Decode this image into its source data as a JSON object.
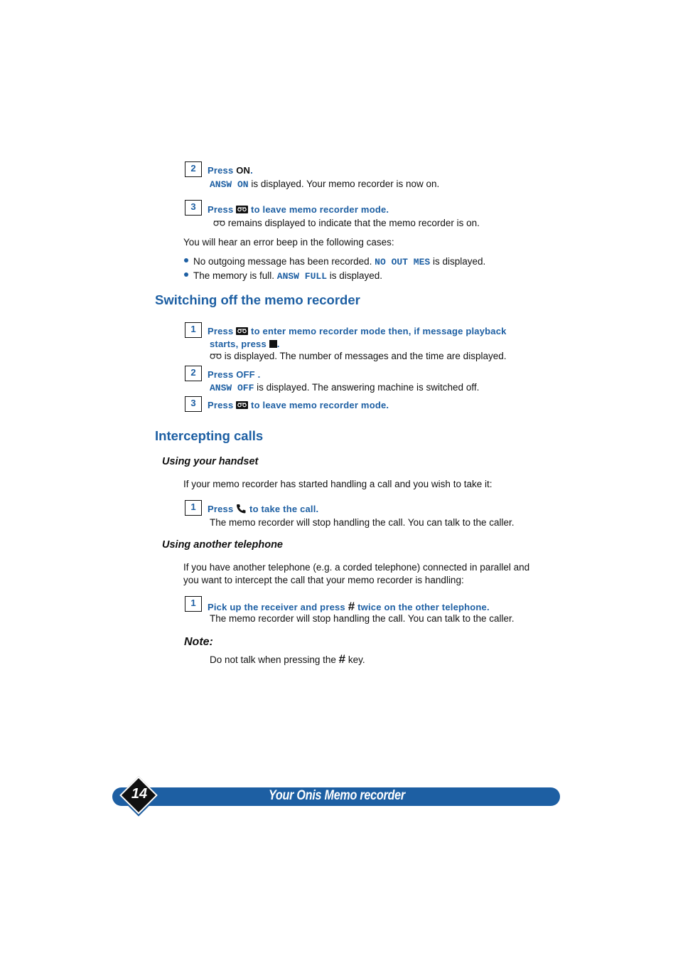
{
  "section_top": {
    "steps": [
      {
        "number": "2",
        "instruction_prefix": "Press ",
        "instruction_key": "ON",
        "instruction_suffix": ".",
        "display_code": "ANSW ON",
        "result": " is displayed.  Your memo recorder is now on."
      },
      {
        "number": "3",
        "instruction_prefix": "Press ",
        "instruction_suffix": " to leave memo recorder mode.",
        "result": " remains displayed to indicate that the memo recorder is on."
      }
    ],
    "error_intro": "You will hear an error beep in the following cases:",
    "error_cases": [
      {
        "text": "No outgoing message has been recorded.  ",
        "code": "NO OUT MES",
        "suffix": " is displayed."
      },
      {
        "text": "The memory is full.  ",
        "code": "ANSW FULL",
        "suffix": " is displayed."
      }
    ]
  },
  "switching_off": {
    "heading": "Switching off the memo recorder",
    "steps": [
      {
        "number": "1",
        "line1_prefix": "Press ",
        "line1_suffix": " to enter memo recorder mode then, if message playback",
        "line2_prefix": "starts,  press ",
        "line2_suffix": ".",
        "result": " is displayed.  The number of messages and the time are displayed."
      },
      {
        "number": "2",
        "instruction": "Press OFF .",
        "display_code": "ANSW OFF",
        "result": " is displayed.  The answering machine is switched off."
      },
      {
        "number": "3",
        "instruction_prefix": "Press ",
        "instruction_suffix": " to leave memo recorder mode."
      }
    ]
  },
  "intercepting": {
    "heading": "Intercepting calls",
    "handset": {
      "subheading": "Using your handset",
      "intro": "If your memo recorder has started handling a call and you wish to take it:",
      "step": {
        "number": "1",
        "instruction_prefix": "Press ",
        "instruction_suffix": "  to take the call.",
        "result": "The memo recorder will stop handling the call.  You can talk to the caller."
      }
    },
    "other_phone": {
      "subheading": "Using another telephone",
      "intro_line1": "If you have another telephone (e.g. a corded telephone) connected in parallel and",
      "intro_line2": "you want to intercept the call that your memo recorder is handling:",
      "step": {
        "number": "1",
        "instruction_prefix": "Pick up the receiver and press  ",
        "instruction_key": "#",
        "instruction_suffix": " twice on the other telephone.",
        "result": "The memo recorder will stop handling the call.  You can talk to the caller."
      }
    },
    "note": {
      "label": "Note:",
      "text_prefix": "Do not talk when pressing the ",
      "key": "#",
      "text_suffix": " key."
    }
  },
  "footer": {
    "page_number": "14",
    "title": "Your Onis Memo recorder"
  },
  "colors": {
    "accent": "#1d5fa3",
    "text": "#111111"
  }
}
